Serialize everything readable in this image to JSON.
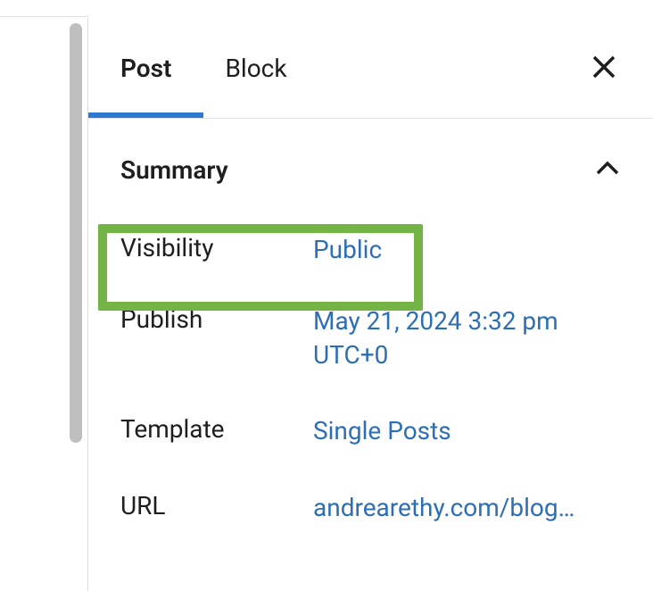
{
  "tabs": {
    "post": "Post",
    "block": "Block"
  },
  "section": {
    "title": "Summary"
  },
  "fields": {
    "visibility": {
      "label": "Visibility",
      "value": "Public"
    },
    "publish": {
      "label": "Publish",
      "value": "May 21, 2024 3:32 pm UTC+0"
    },
    "template": {
      "label": "Template",
      "value": "Single Posts"
    },
    "url": {
      "label": "URL",
      "value": "andrearethy.com/blog…"
    }
  }
}
